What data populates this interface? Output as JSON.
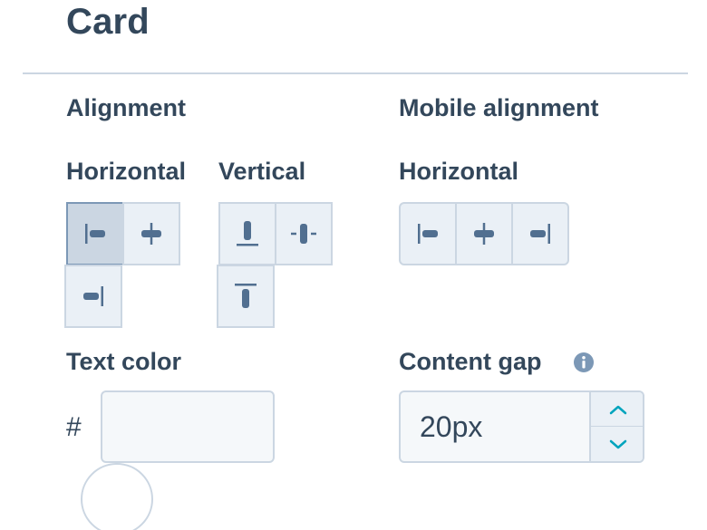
{
  "panel": {
    "title": "Card"
  },
  "alignment": {
    "heading": "Alignment",
    "horizontal": {
      "label": "Horizontal",
      "options": [
        {
          "name": "align-left",
          "selected": true
        },
        {
          "name": "align-center",
          "selected": false
        },
        {
          "name": "align-right",
          "selected": false
        }
      ]
    },
    "vertical": {
      "label": "Vertical",
      "options": [
        {
          "name": "align-bottom",
          "selected": false
        },
        {
          "name": "align-middle",
          "selected": false
        },
        {
          "name": "align-top",
          "selected": false
        }
      ]
    }
  },
  "mobile_alignment": {
    "heading": "Mobile alignment",
    "horizontal": {
      "label": "Horizontal",
      "options": [
        {
          "name": "align-left",
          "selected": false
        },
        {
          "name": "align-center",
          "selected": false
        },
        {
          "name": "align-right",
          "selected": false
        }
      ]
    }
  },
  "text_color": {
    "label": "Text color",
    "prefix": "#",
    "value": "",
    "swatch_color": "#ffffff"
  },
  "content_gap": {
    "label": "Content gap",
    "value": "20px",
    "info_icon": "info-icon"
  },
  "colors": {
    "text": "#33475b",
    "border": "#cbd6e2",
    "button_bg": "#eaf0f6",
    "selected_bg": "#cbd6e2",
    "icon": "#516f90",
    "accent": "#00a4bd",
    "info": "#7c98b6"
  }
}
